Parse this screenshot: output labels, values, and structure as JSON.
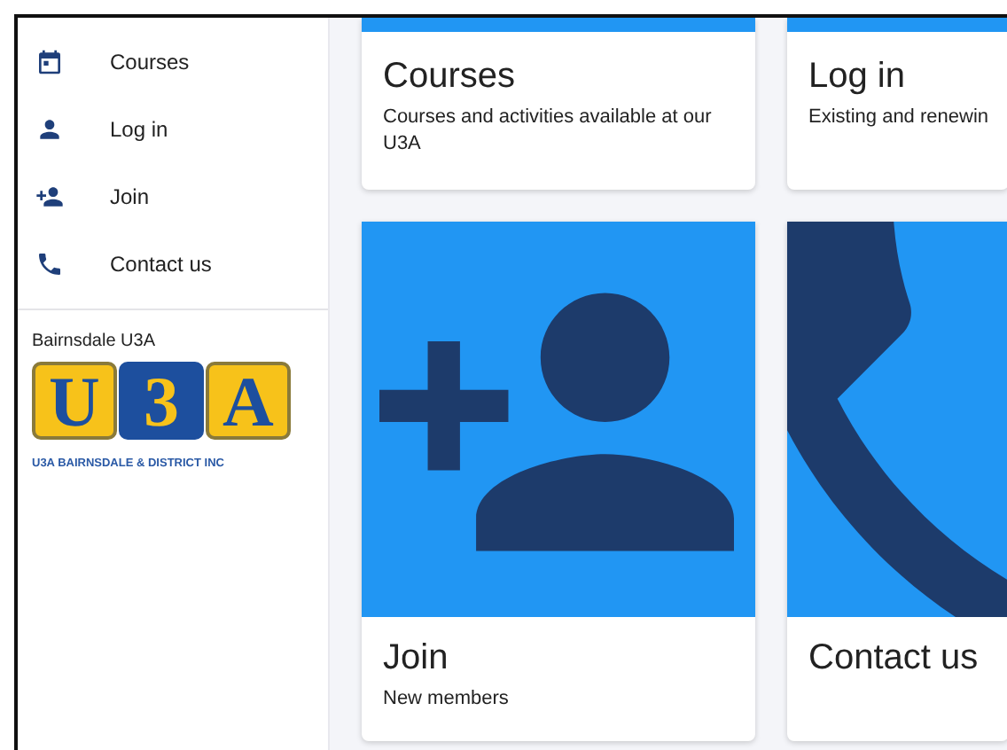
{
  "sidebar": {
    "items": [
      {
        "label": "Courses"
      },
      {
        "label": "Log in"
      },
      {
        "label": "Join"
      },
      {
        "label": "Contact us"
      }
    ],
    "site_name": "Bairnsdale U3A",
    "logo": {
      "letters": [
        "U",
        "3",
        "A"
      ],
      "tagline": "U3A BAIRNSDALE & DISTRICT INC"
    }
  },
  "cards": [
    {
      "kind": "strip",
      "title": "Courses",
      "description": "Courses and activities available at our U3A"
    },
    {
      "kind": "strip",
      "title": "Log in",
      "description": "Existing and renewin"
    },
    {
      "kind": "picture",
      "title": "Join",
      "description": "New members"
    },
    {
      "kind": "picture",
      "title": "Contact us"
    }
  ]
}
